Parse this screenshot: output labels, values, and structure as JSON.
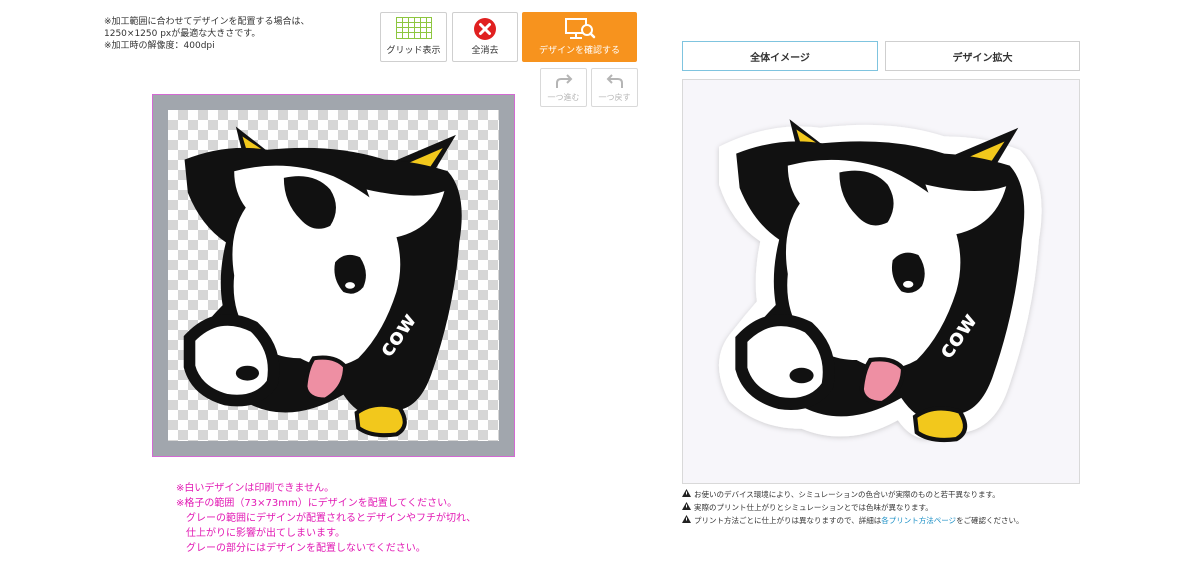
{
  "info": {
    "line1": "※加工範囲に合わせてデザインを配置する場合は、",
    "line2": "1250×1250 pxが最適な大きさです。",
    "line3": "※加工時の解像度：400dpi"
  },
  "toolbar": {
    "grid_label": "グリッド表示",
    "clear_label": "全消去",
    "confirm_label": "デザインを確認する",
    "redo_label": "一つ進む",
    "undo_label": "一つ戻す"
  },
  "canvas": {
    "design_text": "cow"
  },
  "warnings": {
    "line1": "※白いデザインは印刷できません。",
    "line2": "※格子の範囲（73×73mm）にデザインを配置してください。",
    "line3": "グレーの範囲にデザインが配置されるとデザインやフチが切れ、",
    "line4": "仕上がりに影響が出てしまいます。",
    "line5": "グレーの部分にはデザインを配置しないでください。"
  },
  "tabs": {
    "overall": "全体イメージ",
    "zoom": "デザイン拡大",
    "active": "overall"
  },
  "preview": {
    "design_text": "cow"
  },
  "notes": {
    "line1": "お使いのデバイス環境により、シミュレーションの色合いが実際のものと若干異なります。",
    "line2": "実際のプリント仕上がりとシミュレーションとでは色味が異なります。",
    "line3_pre": "プリント方法ごとに仕上がりは異なりますので、詳細は",
    "line3_link": "各プリント方法ページ",
    "line3_post": "をご確認ください。"
  },
  "colors": {
    "accent": "#f7931e",
    "warning_text": "#e21ab4",
    "clear_icon": "#e02020",
    "grid_icon": "#8dc63f",
    "link": "#1a8fc6",
    "active_tab_border": "#7fc4df"
  }
}
